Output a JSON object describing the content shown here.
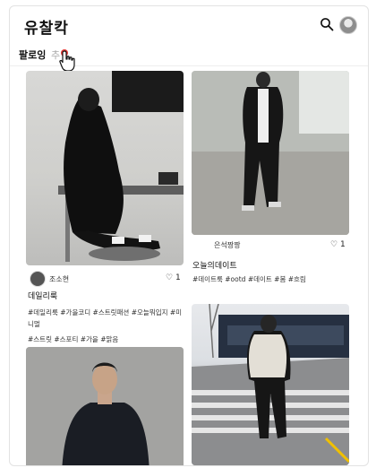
{
  "header": {
    "logo": "유찰칵"
  },
  "tabs": [
    {
      "label": "팔로잉"
    },
    {
      "label": "추"
    }
  ],
  "posts": [
    {
      "user": "조소현",
      "likes": "1",
      "title": "데일리룩",
      "tags_line1": "#데일리룩 #가을코디 #스트릿패션 #오늘뭐입지 #미니멀",
      "tags_line2": "#스트릿 #스포티 #가을 #맑음"
    },
    {
      "user": "은석짱짱",
      "likes": "1",
      "title": "오늘의데이트",
      "tags_line1": "#데이트룩 #ootd #데이트 #봄 #흐림"
    }
  ],
  "icons": {
    "search": "search-icon",
    "avatar": "profile-avatar",
    "like": "heart-icon",
    "cursor": "hand-pointer-icon"
  },
  "colors": {
    "notification_dot": "#e53935",
    "accent": "#111111"
  }
}
